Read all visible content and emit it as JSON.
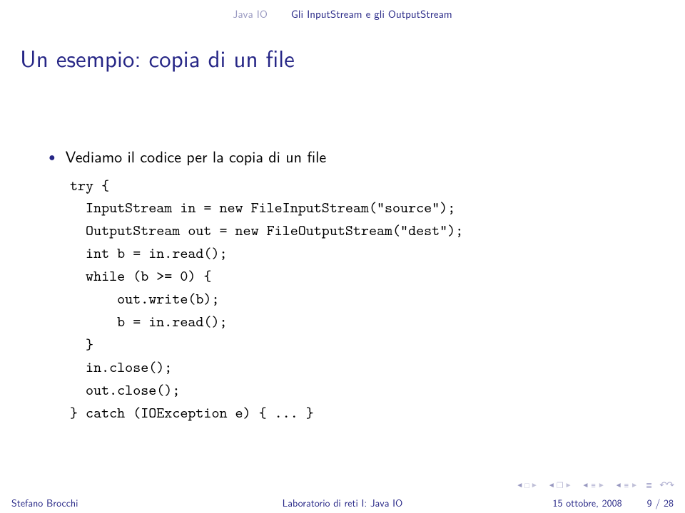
{
  "header": {
    "section": "Java IO",
    "subsection": "Gli InputStream e gli OutputStream"
  },
  "title": "Un esempio: copia di un file",
  "bullet": "Vediamo il codice per la copia di un file",
  "code": "try {\n  InputStream in = new FileInputStream(\"source\");\n  OutputStream out = new FileOutputStream(\"dest\");\n  int b = in.read();\n  while (b >= 0) {\n      out.write(b);\n      b = in.read();\n  }\n  in.close();\n  out.close();\n} catch (IOException e) { ... }",
  "footer": {
    "author": "Stefano Brocchi",
    "mid": "Laboratorio di reti I: Java IO",
    "date": "15 ottobre, 2008",
    "page": "9 / 28"
  }
}
